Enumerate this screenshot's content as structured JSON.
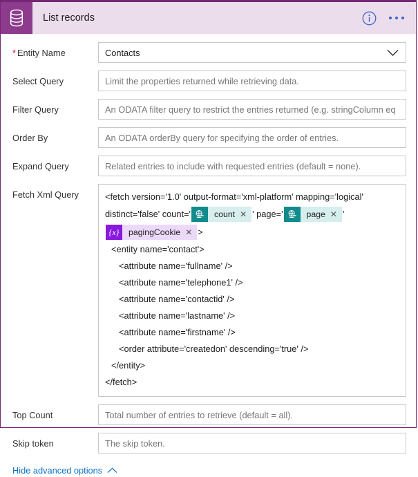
{
  "header": {
    "title": "List records",
    "connector_icon": "database-icon",
    "info_icon": "info-icon",
    "more_icon": "ellipsis-icon",
    "icon_bg": "#8d3b8d",
    "bar_bg": "#ecddec",
    "accent": "#742774"
  },
  "fields": [
    {
      "label": "Entity Name",
      "required": true,
      "type": "select",
      "value": "Contacts",
      "chevron_icon": "chevron-down-icon"
    },
    {
      "label": "Select Query",
      "required": false,
      "type": "text",
      "placeholder": "Limit the properties returned while retrieving data."
    },
    {
      "label": "Filter Query",
      "required": false,
      "type": "text",
      "placeholder": "An ODATA filter query to restrict the entries returned (e.g. stringColumn eq"
    },
    {
      "label": "Order By",
      "required": false,
      "type": "text",
      "placeholder": "An ODATA orderBy query for specifying the order of entries."
    },
    {
      "label": "Expand Query",
      "required": false,
      "type": "text",
      "placeholder": "Related entries to include with requested entries (default = none)."
    }
  ],
  "fetch_xml": {
    "label": "Fetch Xml Query",
    "line1": "<fetch version='1.0' output-format='xml-platform' mapping='logical'",
    "seg_a": "distinct='false' count='",
    "seg_b": "' page='",
    "seg_c": "'",
    "seg_d": ">",
    "tokens": [
      {
        "name": "count",
        "kind": "cds",
        "icon": "common-data-service-icon",
        "remove_icon": "remove-token-icon"
      },
      {
        "name": "page",
        "kind": "cds",
        "icon": "common-data-service-icon",
        "remove_icon": "remove-token-icon"
      },
      {
        "name": "pagingCookie",
        "kind": "var",
        "icon": "variable-icon",
        "remove_icon": "remove-token-icon"
      }
    ],
    "lines": [
      {
        "indent": 1,
        "text": "<entity name='contact'>"
      },
      {
        "indent": 2,
        "text": "<attribute name='fullname' />"
      },
      {
        "indent": 2,
        "text": "<attribute name='telephone1' />"
      },
      {
        "indent": 2,
        "text": "<attribute name='contactid' />"
      },
      {
        "indent": 2,
        "text": "<attribute name='lastname' />"
      },
      {
        "indent": 2,
        "text": "<attribute name='firstname' />"
      },
      {
        "indent": 2,
        "text": "<order attribute='createdon' descending='true' />"
      },
      {
        "indent": 1,
        "text": "</entity>"
      },
      {
        "indent": 0,
        "text": "</fetch>"
      }
    ]
  },
  "fields_bottom": [
    {
      "label": "Top Count",
      "required": false,
      "type": "text",
      "placeholder": "Total number of entries to retrieve (default = all)."
    },
    {
      "label": "Skip token",
      "required": false,
      "type": "text",
      "placeholder": "The skip token."
    }
  ],
  "footer": {
    "advanced_label": "Hide advanced options",
    "chevron_icon": "chevron-up-icon",
    "link_color": "#0b72c4"
  }
}
